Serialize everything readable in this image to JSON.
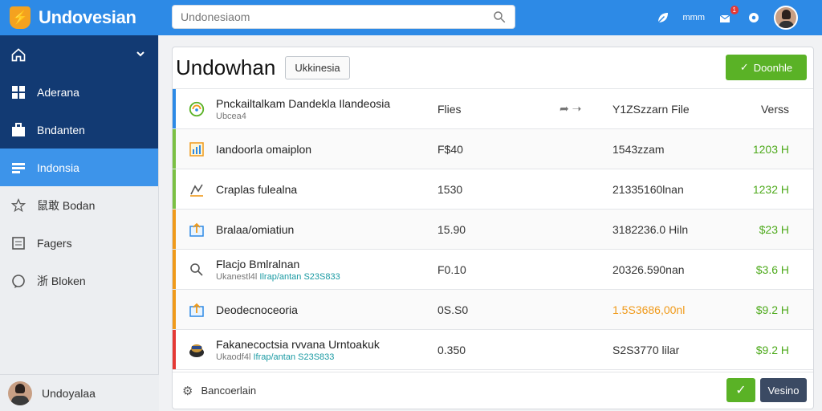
{
  "app": {
    "title": "Undovesian"
  },
  "search": {
    "placeholder": "Undonesiaom"
  },
  "header": {
    "link": "mmm",
    "badge": "1"
  },
  "sidebar": {
    "items": [
      {
        "label": "",
        "icon": "home-icon"
      },
      {
        "label": "Aderana",
        "icon": "grid-icon"
      },
      {
        "label": "Bndanten",
        "icon": "briefcase-icon"
      },
      {
        "label": "Indonsia",
        "icon": "list-icon"
      },
      {
        "label": "鼠敢 Bodan",
        "icon": "star-icon"
      },
      {
        "label": "Fagers",
        "icon": "document-icon"
      },
      {
        "label": "浙 Bloken",
        "icon": "chat-icon"
      }
    ],
    "user": "Undoyalaa"
  },
  "panel": {
    "title": "Undowhan",
    "chip": "Ukkinesia",
    "primary_button": "Doonhle",
    "columns": {
      "files": "Flies",
      "file": "Y1ZSzzarn File",
      "version": "Verss"
    },
    "rows": [
      {
        "name": "Pnckailtalkam Dandekla Ilandeosia",
        "sub": "Ubcea4",
        "files": "",
        "file": "",
        "version": "",
        "accent": "#2d8ae6",
        "icon": "globe-icon"
      },
      {
        "name": "Iandoorla omaiplon",
        "sub": "",
        "files": "F$40",
        "file": "1543zzam",
        "version": "1203 H",
        "accent": "#7bc043",
        "icon": "chart-icon"
      },
      {
        "name": "Craplas fulealna",
        "sub": "",
        "files": "1530",
        "file": "21335160lnan",
        "version": "1232 H",
        "accent": "#7bc043",
        "icon": "chart-line-icon"
      },
      {
        "name": "Bralaa/omiatiun",
        "sub": "",
        "files": "15.90",
        "file": "3182236.0 Hiln",
        "version": "$23 H",
        "accent": "#f09a1a",
        "icon": "upload-icon"
      },
      {
        "name": "Flacjo Bmlralnan",
        "sub_prefix": "Ukanestl4l",
        "sub_hl": "Ilrap/antan S23S833",
        "files": "F0.10",
        "file": "20326.590nan",
        "version": "$3.6 H",
        "accent": "#f09a1a",
        "icon": "search-icon"
      },
      {
        "name": "Deodecnoceoria",
        "sub": "",
        "files": "0S.S0",
        "file": "1.5S3686,00nl",
        "version": "$9.2 H",
        "accent": "#f09a1a",
        "icon": "upload-icon"
      },
      {
        "name": "Fakanecoctsia rvvana Urntoakuk",
        "sub_prefix": "Ukaodf4l",
        "sub_hl": "Ifrap/antan S23S833",
        "files": "0.350",
        "file": "S2S3770 lilar",
        "version": "$9.2 H",
        "accent": "#e53935",
        "icon": "archive-icon"
      }
    ]
  },
  "footer": {
    "label": "Bancoerlain",
    "dark_button": "Vesino"
  },
  "colors": {
    "topbar": "#2d8ae6",
    "sidebar_dark": "#123a73",
    "active": "#3d94ea",
    "green": "#5ab226"
  }
}
